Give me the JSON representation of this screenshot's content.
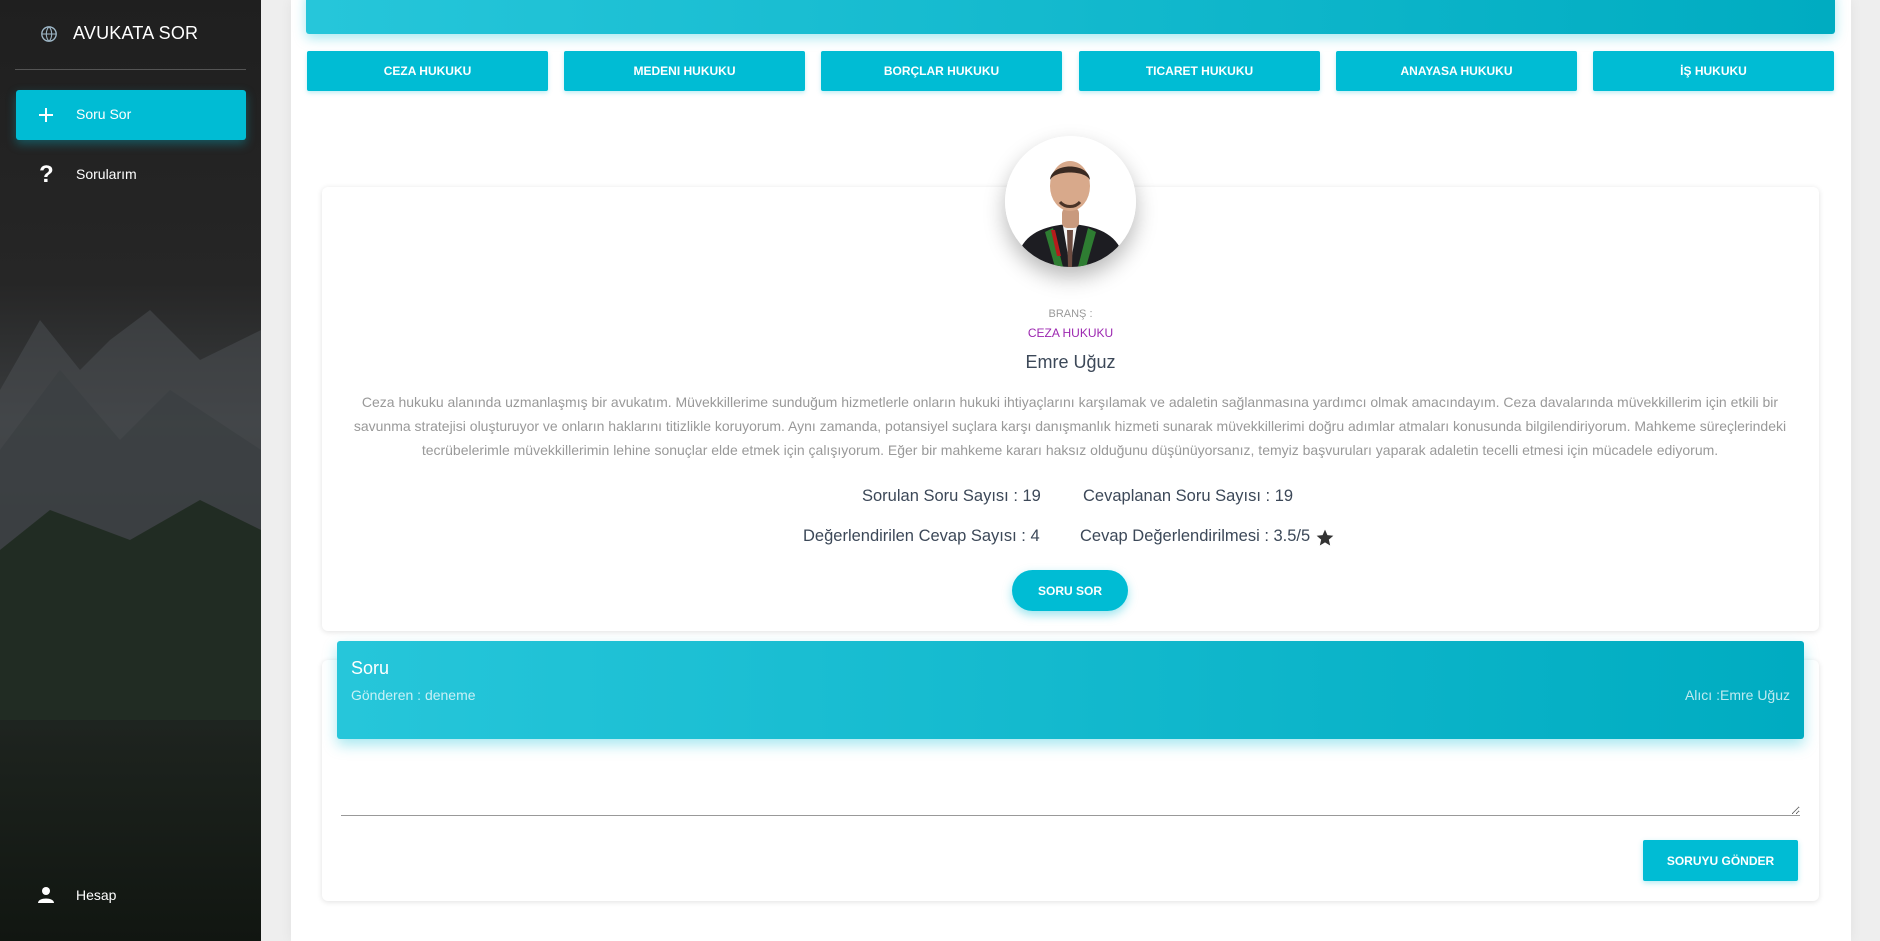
{
  "sidebar": {
    "brand_title": "AVUKATA SOR",
    "items": [
      {
        "label": "Soru Sor",
        "icon": "plus-icon",
        "active": true
      },
      {
        "label": "Sorularım",
        "icon": "question-icon",
        "active": false
      }
    ],
    "account_label": "Hesap"
  },
  "categories": [
    "CEZA HUKUKU",
    "MEDENI HUKUKU",
    "BORÇLAR HUKUKU",
    "TICARET HUKUKU",
    "ANAYASA HUKUKU",
    "İŞ HUKUKU"
  ],
  "profile": {
    "branch_label": "BRANŞ :",
    "branch_value": "CEZA HUKUKU",
    "name": "Emre Uğuz",
    "bio": "Ceza hukuku alanında uzmanlaşmış bir avukatım. Müvekkillerime sunduğum hizmetlerle onların hukuki ihtiyaçlarını karşılamak ve adaletin sağlanmasına yardımcı olmak amacındayım. Ceza davalarında müvekkillerim için etkili bir savunma stratejisi oluşturuyor ve onların haklarını titizlikle koruyorum. Aynı zamanda, potansiyel suçlara karşı danışmanlık hizmeti sunarak müvekkillerimi doğru adımlar atmaları konusunda bilgilendiriyorum. Mahkeme süreçlerindeki tecrübelerimle müvekkillerimin lehine sonuçlar elde etmek için çalışıyorum. Eğer bir mahkeme kararı haksız olduğunu düşünüyorsanız, temyiz başvuruları yaparak adaletin tecelli etmesi için mücadele ediyorum.",
    "asked_count": "Sorulan Soru Sayısı : 19",
    "answered_count": "Cevaplanan Soru Sayısı : 19",
    "rated_count": "Değerlendirilen Cevap Sayısı : 4",
    "rating": "Cevap Değerlendirilmesi : 3.5/5",
    "ask_button": "SORU SOR"
  },
  "question": {
    "title": "Soru",
    "sender": "Gönderen : deneme",
    "recipient": "Alıcı :Emre Uğuz",
    "textarea_value": "",
    "send_button": "SORUYU GÖNDER"
  },
  "colors": {
    "accent": "#00bcd4",
    "branch": "#9c27b0"
  }
}
